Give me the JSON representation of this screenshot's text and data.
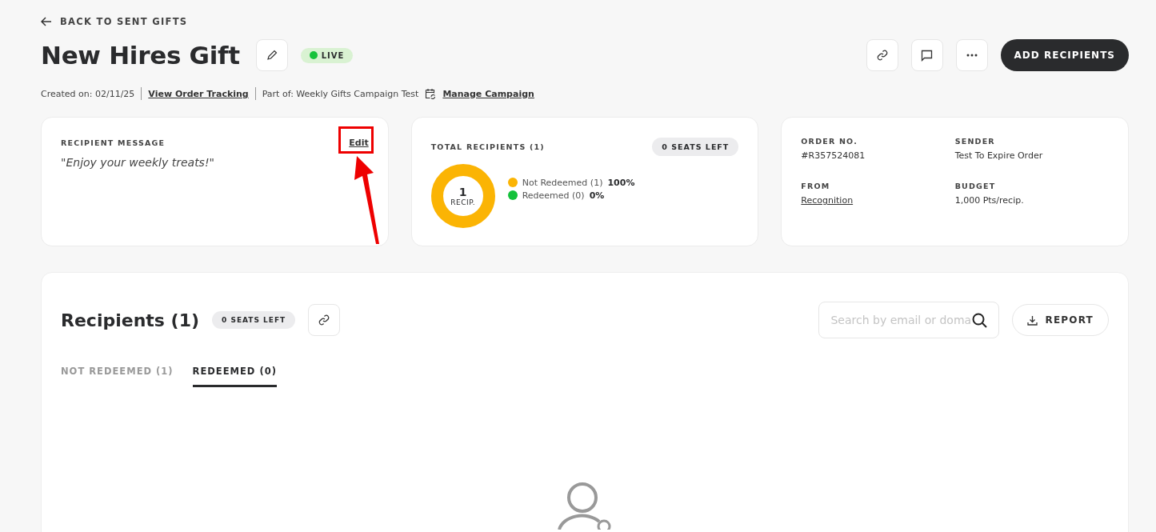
{
  "back_link": "BACK TO SENT GIFTS",
  "header": {
    "title": "New Hires Gift",
    "status": {
      "label": "LIVE",
      "color": "#16c23a"
    },
    "primary_button": "ADD RECIPIENTS"
  },
  "meta": {
    "created": "Created on: 02/11/25",
    "tracking_link": "View Order Tracking",
    "part_of": "Part of: Weekly Gifts Campaign Test",
    "campaign_link": "Manage Campaign"
  },
  "message_card": {
    "label": "RECIPIENT MESSAGE",
    "edit": "Edit",
    "message": "\"Enjoy your weekly treats!\""
  },
  "recipients_card": {
    "label": "TOTAL RECIPIENTS (1)",
    "seats": "0 SEATS LEFT",
    "donut_value": "1",
    "donut_unit": "RECIP.",
    "legend": [
      {
        "label": "Not Redeemed (1)",
        "percent": "100%",
        "color": "#fbb404"
      },
      {
        "label": "Redeemed (0)",
        "percent": "0%",
        "color": "#14c13b"
      }
    ]
  },
  "order_card": {
    "fields": [
      {
        "label": "ORDER NO.",
        "value": "#R357524081",
        "kind": "text"
      },
      {
        "label": "SENDER",
        "value": "Test To Expire Order",
        "kind": "text"
      },
      {
        "label": "FROM",
        "value": "Recognition",
        "kind": "link"
      },
      {
        "label": "BUDGET",
        "value": "1,000 Pts/recip.",
        "kind": "text"
      }
    ]
  },
  "recipients_panel": {
    "title": "Recipients (1)",
    "seats": "0 SEATS LEFT",
    "search": {
      "placeholder": "Search by email or doma"
    },
    "report_button": "REPORT",
    "tabs": [
      {
        "label": "NOT REDEEMED (1)",
        "selected": false
      },
      {
        "label": "REDEEMED (0)",
        "selected": true
      }
    ]
  }
}
